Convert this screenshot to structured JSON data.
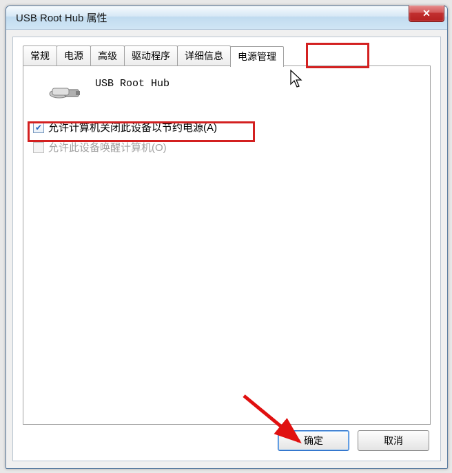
{
  "window": {
    "title": "USB Root Hub 属性"
  },
  "tabs": {
    "t0": "常规",
    "t1": "电源",
    "t2": "高级",
    "t3": "驱动程序",
    "t4": "详细信息",
    "t5": "电源管理"
  },
  "device": {
    "name": "USB Root Hub"
  },
  "options": {
    "allow_off": "允许计算机关闭此设备以节约电源(A)",
    "allow_wake": "允许此设备唤醒计算机(O)"
  },
  "buttons": {
    "ok": "确定",
    "cancel": "取消"
  }
}
